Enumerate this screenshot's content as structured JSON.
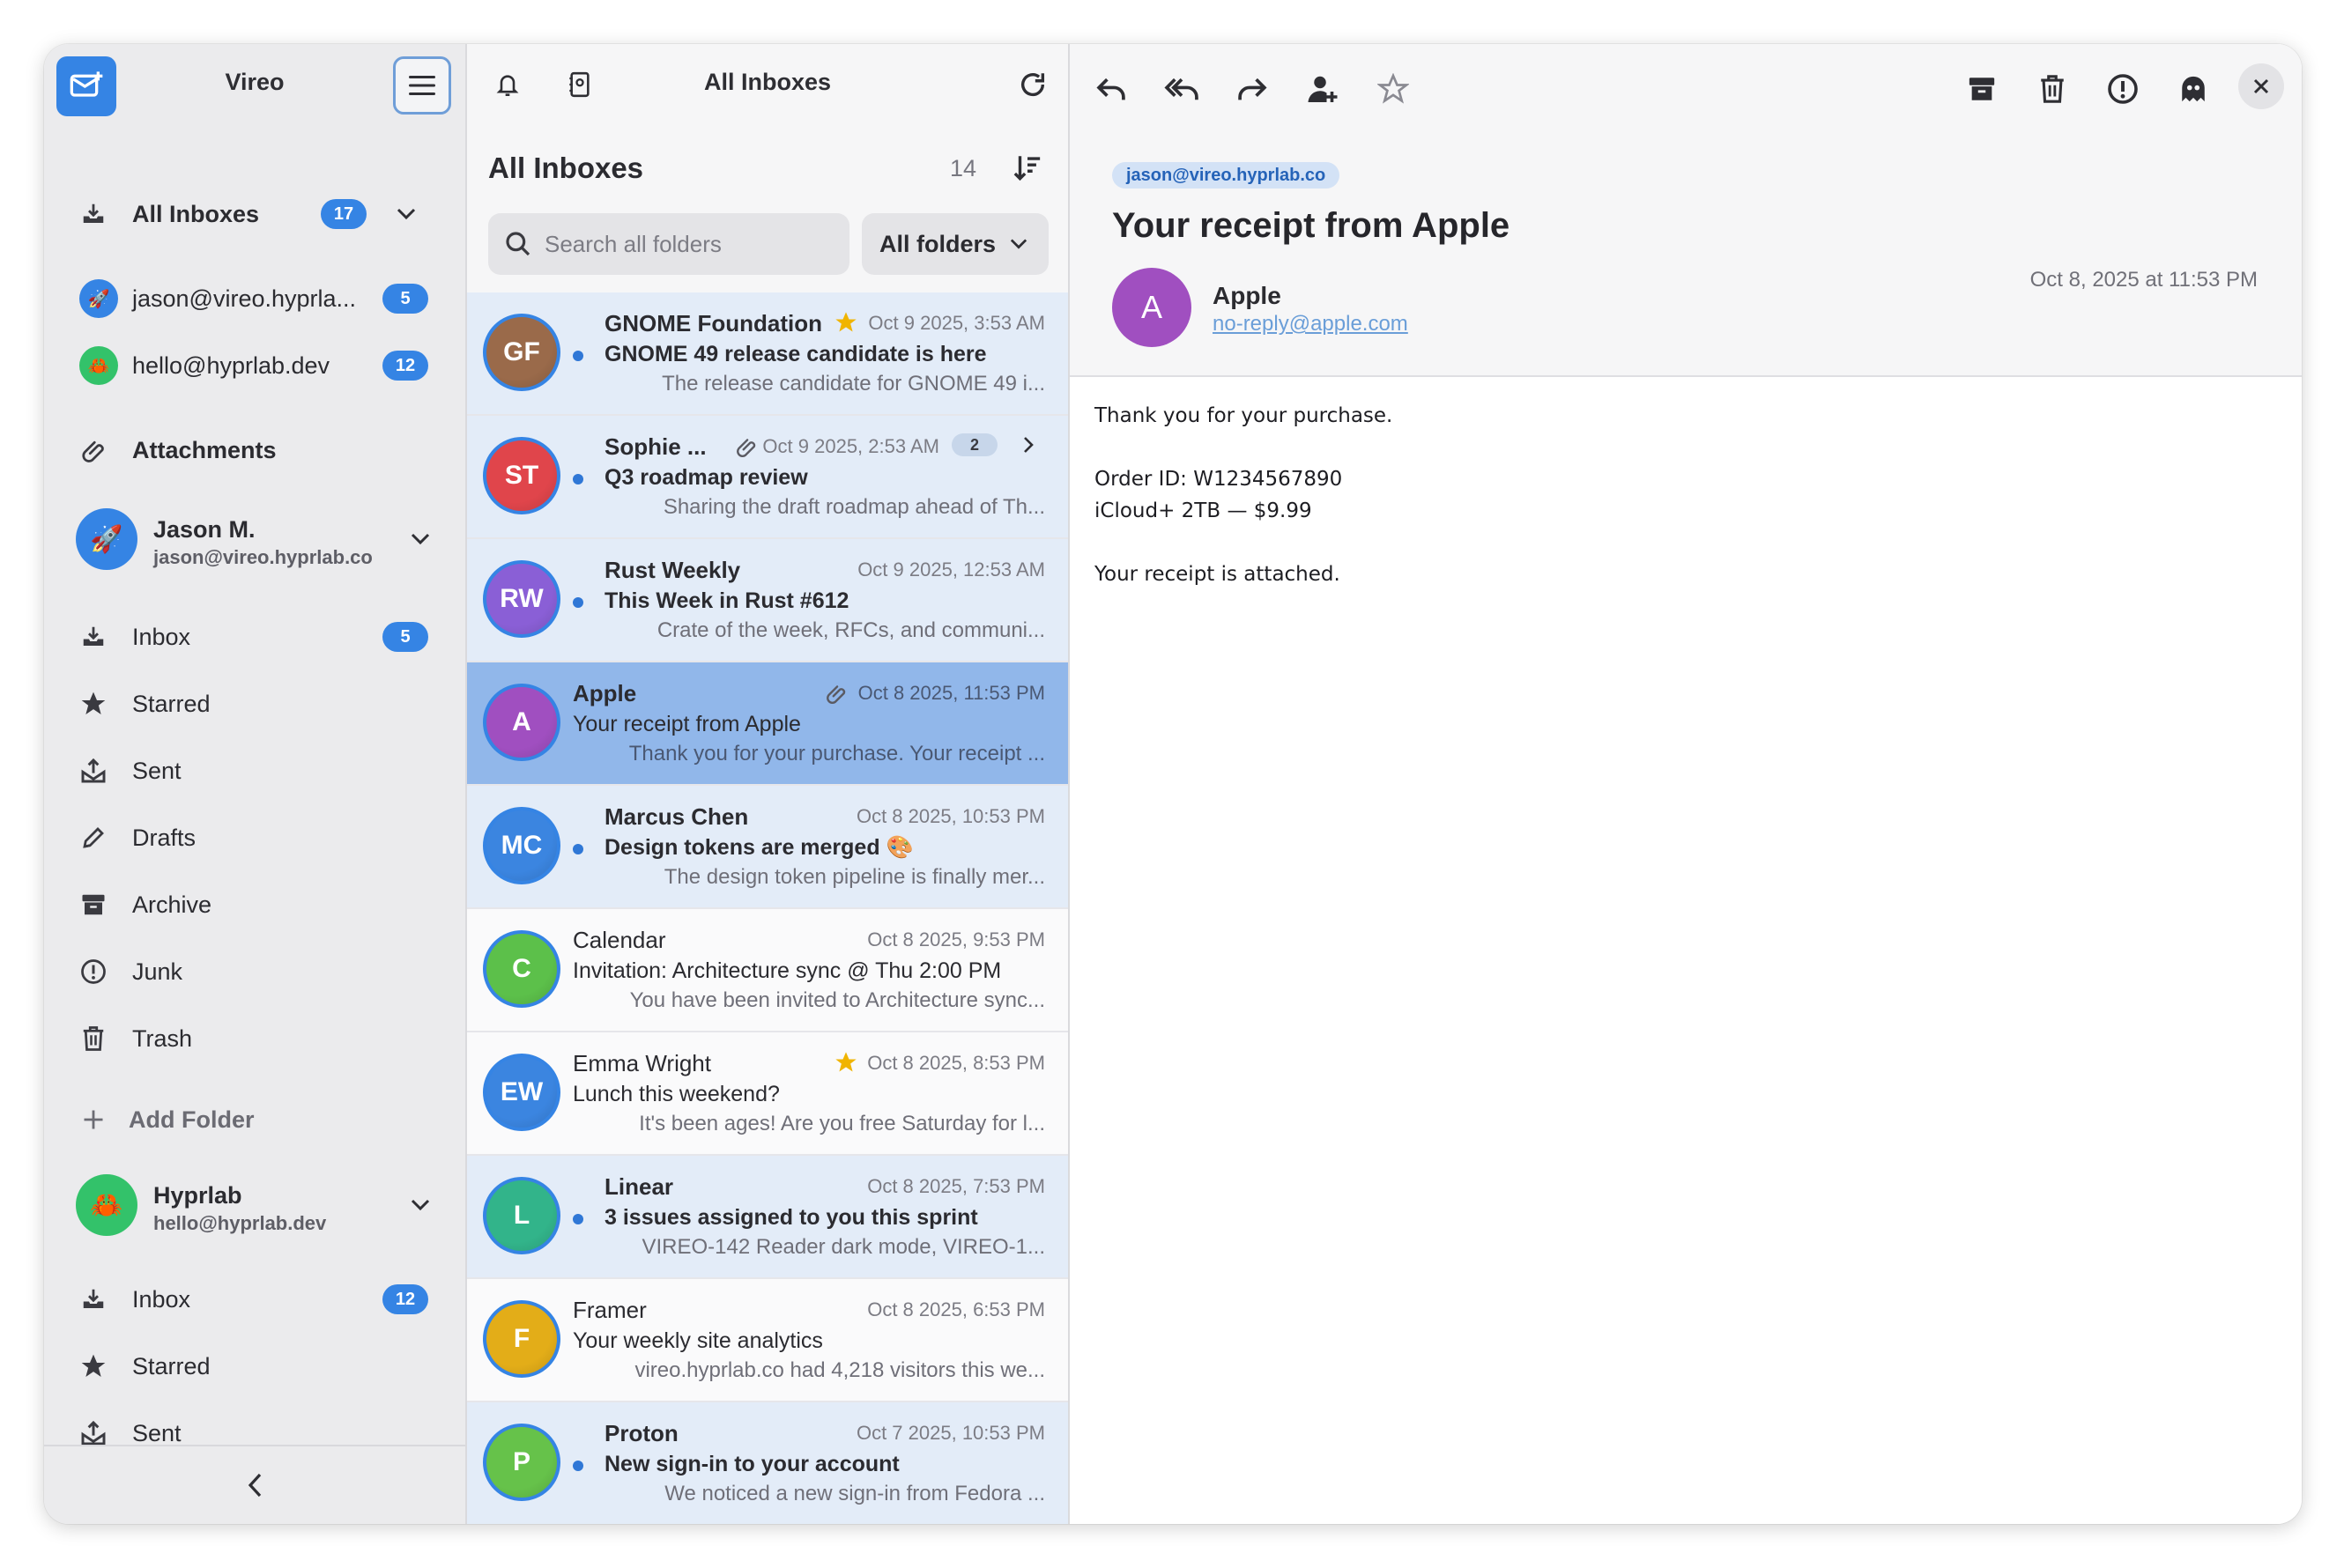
{
  "app": {
    "title": "Vireo"
  },
  "sidebar": {
    "all_inboxes": {
      "label": "All Inboxes",
      "count": "17"
    },
    "accounts_quick": [
      {
        "email": "jason@vireo.hyprla...",
        "count": "5",
        "emoji": "🚀",
        "color": "#3584e4"
      },
      {
        "email": "hello@hyprlab.dev",
        "count": "12",
        "emoji": "🦀",
        "color": "#33c26a"
      }
    ],
    "attachments_label": "Attachments",
    "account1": {
      "name": "Jason M.",
      "email": "jason@vireo.hyprlab.co",
      "emoji": "🚀",
      "color": "#3584e4",
      "folders": [
        {
          "label": "Inbox",
          "icon": "inbox-icon",
          "count": "5"
        },
        {
          "label": "Starred",
          "icon": "star-icon"
        },
        {
          "label": "Sent",
          "icon": "sent-icon"
        },
        {
          "label": "Drafts",
          "icon": "pencil-icon"
        },
        {
          "label": "Archive",
          "icon": "archive-icon"
        },
        {
          "label": "Junk",
          "icon": "junk-icon"
        },
        {
          "label": "Trash",
          "icon": "trash-icon"
        }
      ]
    },
    "add_folder_label": "Add Folder",
    "account2": {
      "name": "Hyprlab",
      "email": "hello@hyprlab.dev",
      "emoji": "🦀",
      "color": "#33c26a",
      "folders": [
        {
          "label": "Inbox",
          "icon": "inbox-icon",
          "count": "12"
        },
        {
          "label": "Starred",
          "icon": "star-icon"
        },
        {
          "label": "Sent",
          "icon": "sent-icon"
        }
      ]
    }
  },
  "list": {
    "toolbar_title": "All Inboxes",
    "heading": "All Inboxes",
    "count": "14",
    "search_placeholder": "Search all folders",
    "folder_filter": "All folders",
    "messages": [
      {
        "initials": "GF",
        "color": "#9a6a4a",
        "from": "GNOME Foundation",
        "subject": "GNOME 49 release candidate is here",
        "preview": "The release candidate for GNOME 49 i...",
        "date": "Oct 9 2025, 3:53 AM",
        "unread": true,
        "starred": true
      },
      {
        "initials": "ST",
        "color": "#e0454b",
        "from": "Sophie ...",
        "subject": "Q3 roadmap review",
        "preview": "Sharing the draft roadmap ahead of Th...",
        "date": "Oct 9 2025, 2:53 AM",
        "unread": true,
        "attachment": true,
        "thread": "2"
      },
      {
        "initials": "RW",
        "color": "#8a5fd6",
        "from": "Rust Weekly",
        "subject": "This Week in Rust #612",
        "preview": "Crate of the week, RFCs, and communi...",
        "date": "Oct 9 2025, 12:53 AM",
        "unread": true
      },
      {
        "initials": "A",
        "color": "#a04fc0",
        "from": "Apple",
        "subject": "Your receipt from Apple",
        "preview": "Thank you for your purchase. Your receipt ...",
        "date": "Oct 8 2025, 11:53 PM",
        "selected": true,
        "attachment": true
      },
      {
        "initials": "MC",
        "color": "#3b85e0",
        "from": "Marcus Chen",
        "subject": "Design tokens are merged 🎨",
        "preview": "The design token pipeline is finally mer...",
        "date": "Oct 8 2025, 10:53 PM",
        "unread": true
      },
      {
        "initials": "C",
        "color": "#5cc04a",
        "from": "Calendar",
        "subject": "Invitation: Architecture sync @ Thu 2:00 PM",
        "preview": "You have been invited to Architecture sync...",
        "date": "Oct 8 2025, 9:53 PM"
      },
      {
        "initials": "EW",
        "color": "#3b85e0",
        "from": "Emma Wright",
        "subject": "Lunch this weekend?",
        "preview": "It's been ages! Are you free Saturday for l...",
        "date": "Oct 8 2025, 8:53 PM",
        "starred": true
      },
      {
        "initials": "L",
        "color": "#32b48a",
        "from": "Linear",
        "subject": "3 issues assigned to you this sprint",
        "preview": "VIREO-142 Reader dark mode, VIREO-1...",
        "date": "Oct 8 2025, 7:53 PM",
        "unread": true
      },
      {
        "initials": "F",
        "color": "#e3ad18",
        "from": "Framer",
        "subject": "Your weekly site analytics",
        "preview": "vireo.hyprlab.co had 4,218 visitors this we...",
        "date": "Oct 8 2025, 6:53 PM"
      },
      {
        "initials": "P",
        "color": "#66c24a",
        "from": "Proton",
        "subject": "New sign-in to your account",
        "preview": "We noticed a new sign-in from Fedora ...",
        "date": "Oct 7 2025, 10:53 PM",
        "unread": true
      }
    ]
  },
  "reader": {
    "account_pill": "jason@vireo.hyprlab.co",
    "subject": "Your receipt from Apple",
    "sender_initial": "A",
    "sender_name": "Apple",
    "sender_email": "no-reply@apple.com",
    "date": "Oct 8, 2025 at 11:53 PM",
    "body": {
      "line1": "Thank you for your purchase.",
      "line2": "Order ID: W1234567890",
      "line3": "iCloud+ 2TB — $9.99",
      "line4": "Your receipt is attached."
    }
  },
  "colors": {
    "accent": "#3584e4",
    "selected_row": "#91b7ea",
    "unread_row": "#e3ecf8",
    "star": "#f0b400"
  }
}
